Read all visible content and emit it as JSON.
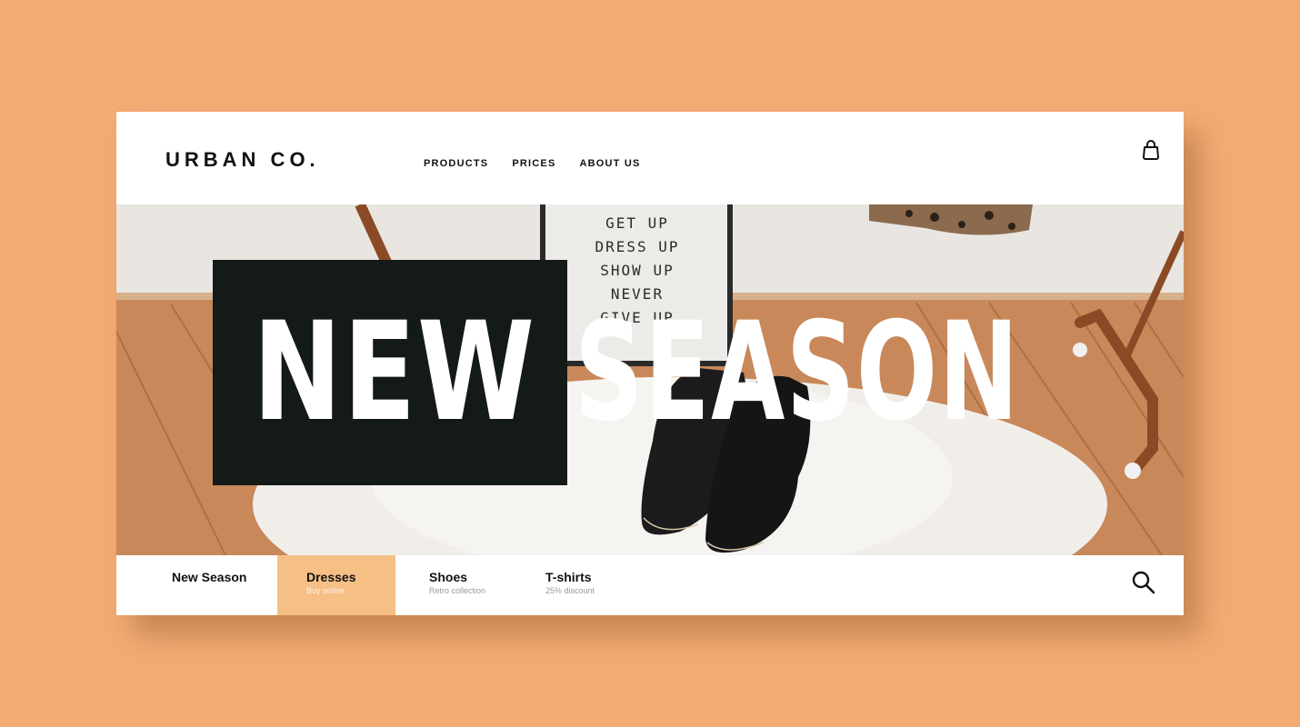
{
  "brand": {
    "logo": "URBAN CO."
  },
  "nav": {
    "items": [
      "PRODUCTS",
      "PRICES",
      "ABOUT US"
    ]
  },
  "hero": {
    "headline_left": "NEW",
    "headline_right": "SEASON",
    "letterboard_lines": [
      "GET UP",
      "DRESS UP",
      "SHOW UP",
      "NEVER",
      "GIVE UP"
    ]
  },
  "categories": [
    {
      "title": "New Season",
      "subtitle": ""
    },
    {
      "title": "Dresses",
      "subtitle": "Buy online",
      "active": true
    },
    {
      "title": "Shoes",
      "subtitle": "Retro collection"
    },
    {
      "title": "T-shirts",
      "subtitle": "25% discount"
    }
  ],
  "icons": {
    "cart": "shopping-bag-icon",
    "search": "search-icon"
  },
  "colors": {
    "background": "#f3ac74",
    "headline_box": "#141a17",
    "active_category": "#f6bf86"
  }
}
